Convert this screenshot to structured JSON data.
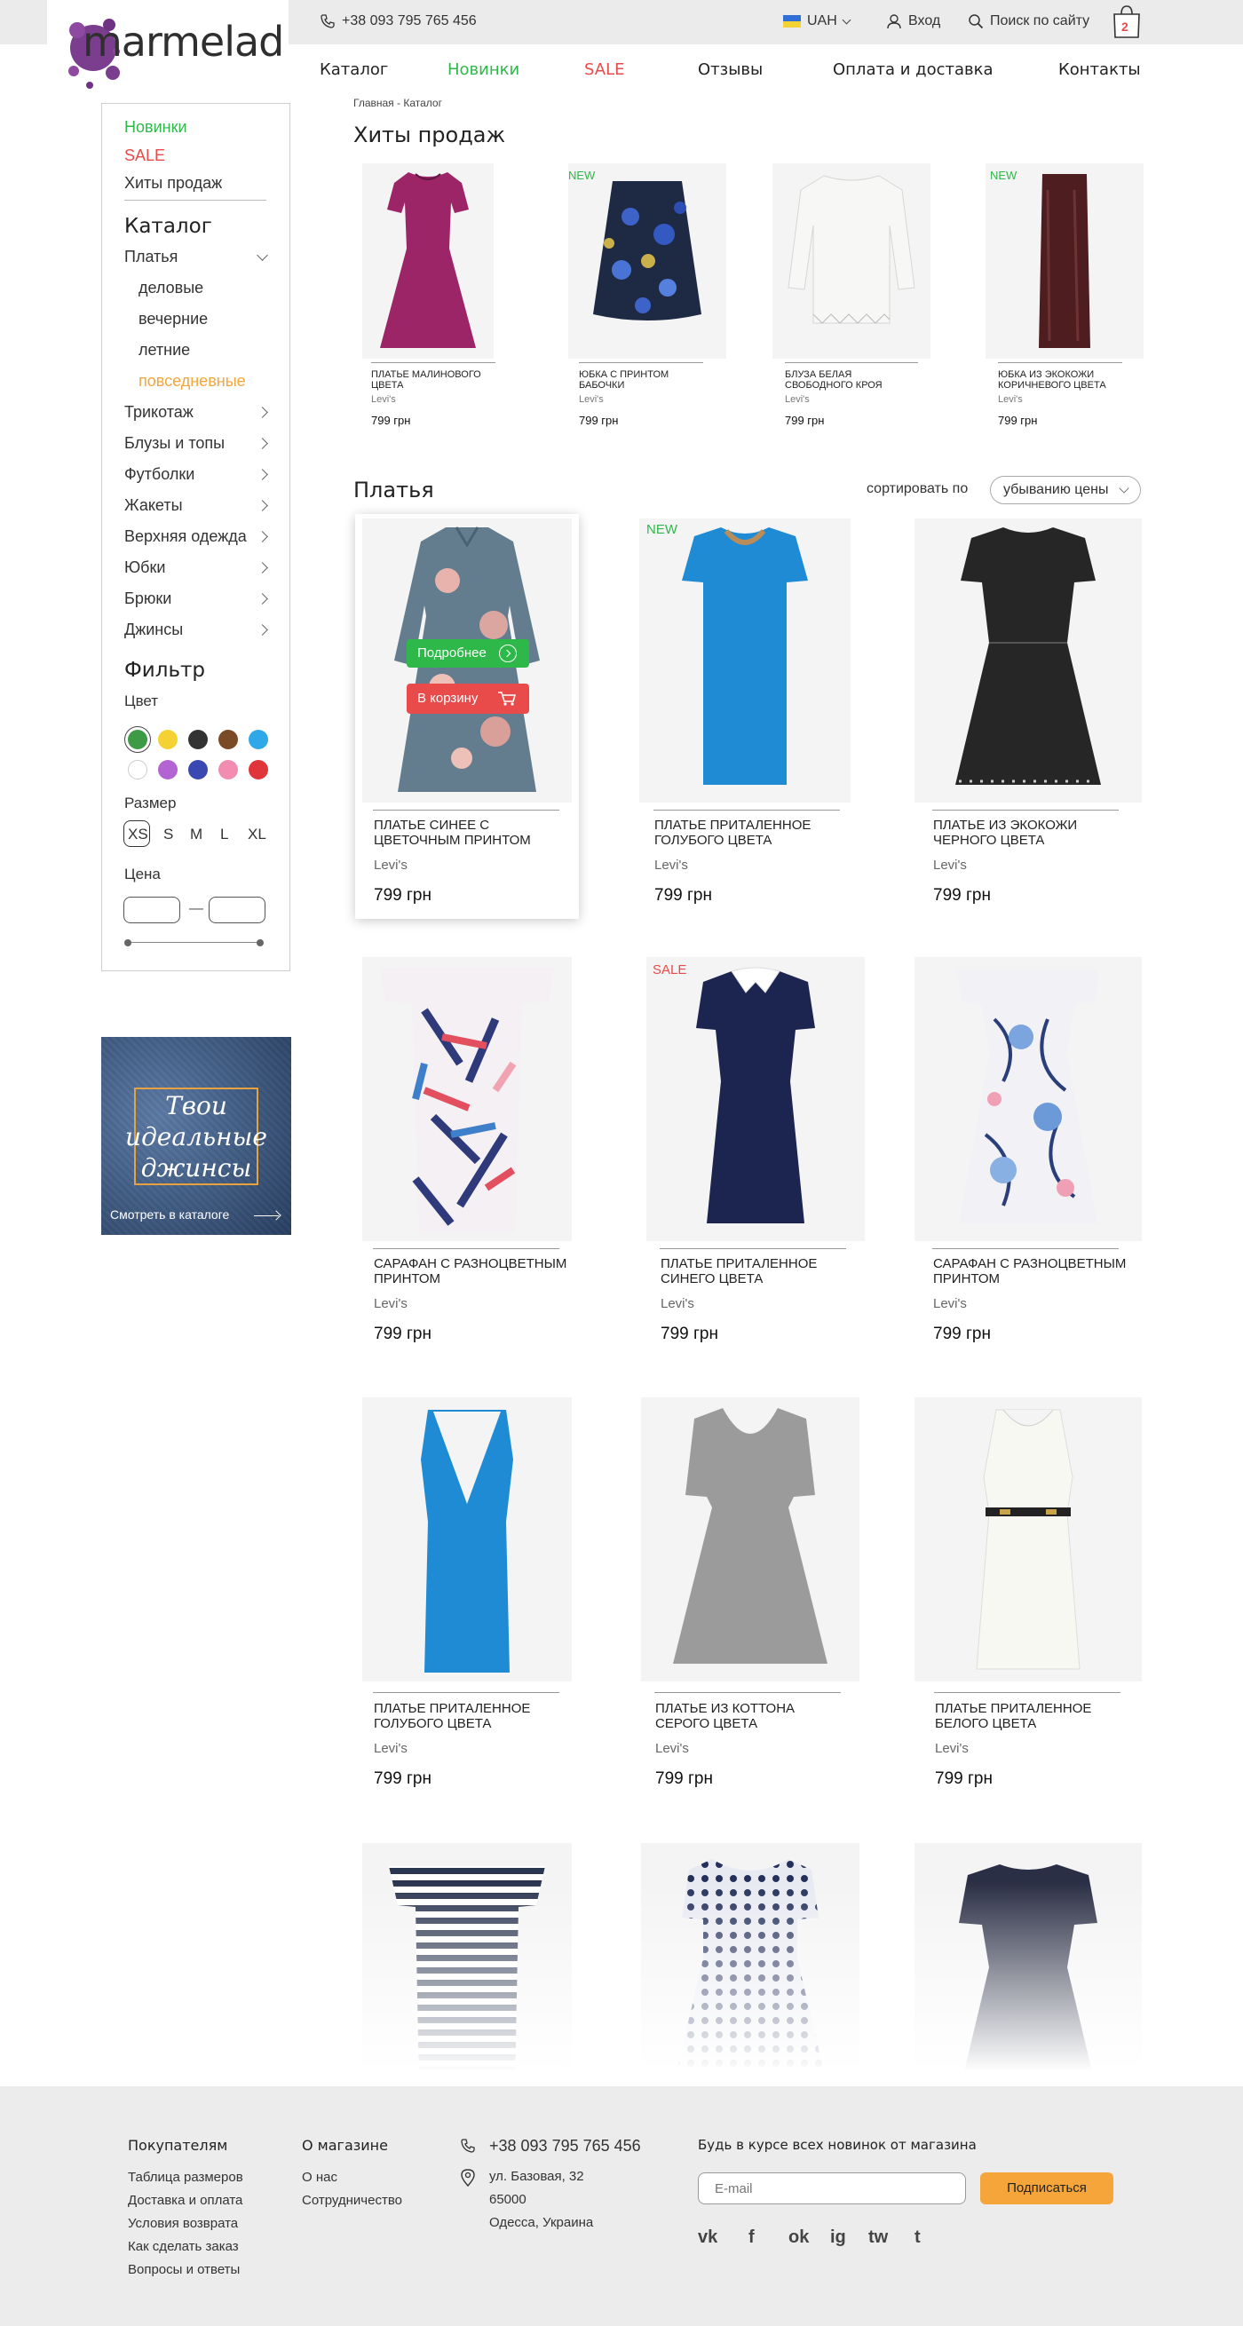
{
  "header": {
    "logo_text": "marmelad",
    "phone": "+38 093 795 765 456",
    "currency": "UAH",
    "login": "Вход",
    "search": "Поиск по сайту",
    "cart_count": "2"
  },
  "nav": {
    "items": [
      "Каталог",
      "Новинки",
      "SALE",
      "Отзывы",
      "Оплата и доставка",
      "Контакты"
    ]
  },
  "sidebar": {
    "new": "Новинки",
    "sale": "SALE",
    "hits": "Хиты продаж",
    "catalog_title": "Каталог",
    "categories": [
      "Платья",
      "деловые",
      "вечерние",
      "летние",
      "повседневные",
      "Трикотаж",
      "Блузы и топы",
      "Футболки",
      "Жакеты",
      "Верхняя одежда",
      "Юбки",
      "Брюки",
      "Джинсы"
    ],
    "filter_title": "Фильтр",
    "color_label": "Цвет",
    "colors": [
      "#3e9a45",
      "#f5d233",
      "#333333",
      "#7b4a26",
      "#2fa8e8",
      "#ffffff",
      "#b264d3",
      "#3949b1",
      "#f28db1",
      "#e0353b"
    ],
    "size_label": "Размер",
    "sizes": [
      "XS",
      "S",
      "M",
      "L",
      "XL"
    ],
    "price_label": "Цена",
    "price_dash": "—"
  },
  "banner": {
    "line1": "Твои",
    "line2": "идеальные",
    "line3": "джинсы",
    "cta": "Смотреть в каталоге"
  },
  "breadcrumb": "Главная - Каталог",
  "hits": {
    "title": "Хиты продаж",
    "items": [
      {
        "name": "Платье малинового цвета",
        "brand": "Levi's",
        "price": "799 грн",
        "badge": ""
      },
      {
        "name": "Юбка с принтом бабочки",
        "brand": "Levi's",
        "price": "799 грн",
        "badge": "NEW"
      },
      {
        "name": "Блуза белая свободного кроя",
        "brand": "Levi's",
        "price": "799 грн",
        "badge": ""
      },
      {
        "name": "Юбка из экокожи коричневого цвета",
        "brand": "Levi's",
        "price": "799 грн",
        "badge": "NEW"
      }
    ]
  },
  "catalog": {
    "title": "Платья",
    "sort_label": "сортировать по",
    "sort_value": "убыванию цены",
    "details_btn": "Подробнее",
    "cart_btn": "В корзину",
    "items": [
      {
        "name": "Платье синее с цветочным принтом",
        "brand": "Levi's",
        "price": "799 грн",
        "badge": ""
      },
      {
        "name": "Платье приталенное голубого цвета",
        "brand": "Levi's",
        "price": "799 грн",
        "badge": "NEW"
      },
      {
        "name": "Платье из экокожи черного цвета",
        "brand": "Levi's",
        "price": "799 грн",
        "badge": ""
      },
      {
        "name": "Сарафан с разноцветным принтом",
        "brand": "Levi's",
        "price": "799 грн",
        "badge": ""
      },
      {
        "name": "Платье приталенное синего цвета",
        "brand": "Levi's",
        "price": "799 грн",
        "badge": "SALE"
      },
      {
        "name": "Сарафан с разноцветным принтом",
        "brand": "Levi's",
        "price": "799 грн",
        "badge": ""
      },
      {
        "name": "Платье приталенное голубого цвета",
        "brand": "Levi's",
        "price": "799 грн",
        "badge": ""
      },
      {
        "name": "Платье из коттона серого цвета",
        "brand": "Levi's",
        "price": "799 грн",
        "badge": ""
      },
      {
        "name": "Платье приталенное белого цвета",
        "brand": "Levi's",
        "price": "799 грн",
        "badge": ""
      }
    ]
  },
  "footer": {
    "buyers_title": "Покупателям",
    "buyers_links": [
      "Таблица размеров",
      "Доставка и оплата",
      "Условия возврата",
      "Как сделать заказ",
      "Вопросы и ответы"
    ],
    "shop_title": "О магазине",
    "shop_links": [
      "О нас",
      "Сотрудничество"
    ],
    "phone": "+38 093 795 765 456",
    "address": [
      "ул. Базовая, 32",
      "65000",
      "Одесса, Украина"
    ],
    "subscribe_title": "Будь в курсе всех новинок от магазина",
    "email_placeholder": "E-mail",
    "subscribe_btn": "Подписаться",
    "socials": [
      "vk",
      "f",
      "ok",
      "ig",
      "tw",
      "t"
    ]
  },
  "accent": {
    "green": "#2fb84a",
    "red": "#e94a4a",
    "orange": "#f5a53a"
  }
}
